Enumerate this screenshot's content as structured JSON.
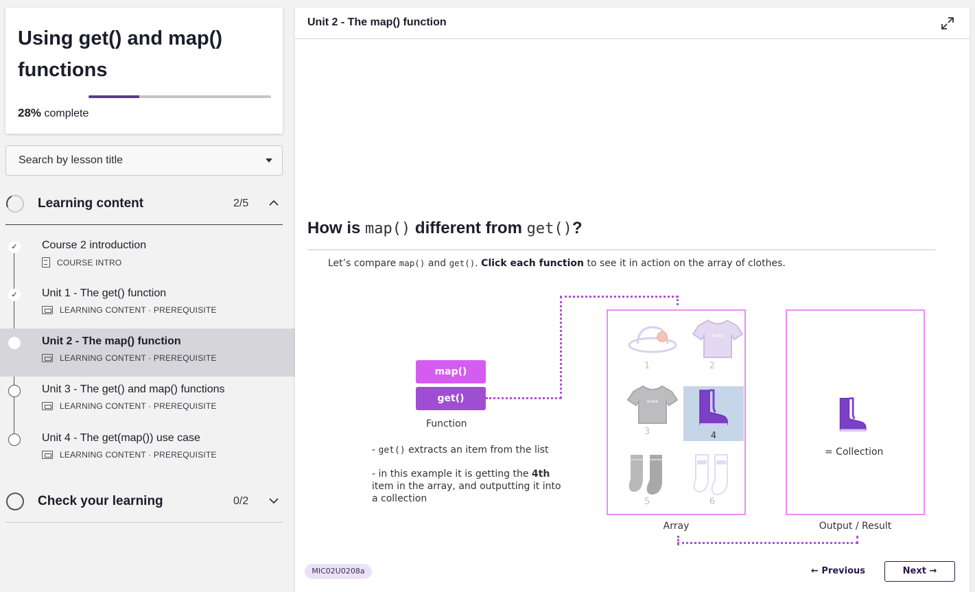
{
  "course": {
    "title": "Using get() and map() functions",
    "progress_percent": 28,
    "progress_value": "28%",
    "progress_suffix": " complete"
  },
  "search": {
    "placeholder": "Search by lesson title"
  },
  "sections": [
    {
      "label": "Learning content",
      "count": "2/5",
      "expanded": true
    },
    {
      "label": "Check your learning",
      "count": "0/2",
      "expanded": false
    }
  ],
  "lessons": [
    {
      "title": "Course 2 introduction",
      "meta": "COURSE INTRO",
      "status": "done",
      "meta_icon": "document-icon"
    },
    {
      "title": "Unit 1 - The get() function",
      "meta": "LEARNING CONTENT · PREREQUISITE",
      "status": "done",
      "meta_icon": "content-icon"
    },
    {
      "title": "Unit 2 - The map() function",
      "meta": "LEARNING CONTENT · PREREQUISITE",
      "status": "current",
      "meta_icon": "content-icon"
    },
    {
      "title": "Unit 3 - The get() and map() functions",
      "meta": "LEARNING CONTENT · PREREQUISITE",
      "status": "todo",
      "meta_icon": "content-icon"
    },
    {
      "title": "Unit 4 - The get(map()) use case",
      "meta": "LEARNING CONTENT · PREREQUISITE",
      "status": "todo",
      "meta_icon": "content-icon"
    }
  ],
  "main": {
    "header_title": "Unit 2 - The map() function",
    "question": {
      "pre": "How is ",
      "code1": "map()",
      "mid": " different from ",
      "code2": "get()",
      "post": "?"
    },
    "intro": {
      "p1": "Let’s compare ",
      "c1": "map()",
      "p2": " and ",
      "c2": "get()",
      "p3": ". ",
      "bold": "Click each function",
      "p4": " to see it in action on the array of clothes."
    },
    "functions": {
      "map_label": "map()",
      "get_label": "get()",
      "caption": "Function"
    },
    "explanation": {
      "line1_pre": "- ",
      "line1_code": "get()",
      "line1_post": " extracts an item from the list",
      "line2_pre": "- in this example it is getting the ",
      "line2_bold": "4th",
      "line2_post": " item in the array, and outputting it into a collection"
    },
    "array": {
      "label": "Array",
      "items": [
        {
          "num": "1",
          "icon": "hat-icon"
        },
        {
          "num": "2",
          "icon": "tshirt-light-icon"
        },
        {
          "num": "3",
          "icon": "tshirt-gray-icon"
        },
        {
          "num": "4",
          "icon": "boots-icon",
          "selected": true
        },
        {
          "num": "5",
          "icon": "socks-gray-icon"
        },
        {
          "num": "6",
          "icon": "socks-light-icon"
        }
      ]
    },
    "output": {
      "label": "Output / Result",
      "collection_label": "= Collection"
    },
    "badge": "MIC02U0208a",
    "nav": {
      "prev": "← Previous",
      "next": "Next →"
    },
    "colors": {
      "accent": "#a04ed1",
      "map_button": "#d55cf0",
      "box_border": "#ef8af5",
      "selected_cell": "#c6d6e9"
    }
  }
}
